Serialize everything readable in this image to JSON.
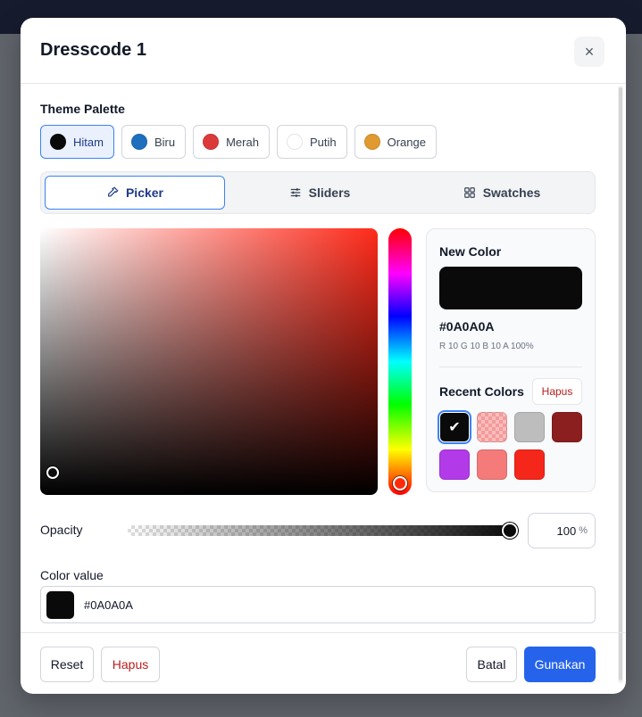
{
  "modal": {
    "title": "Dresscode 1",
    "close_icon": "×"
  },
  "theme_palette": {
    "label": "Theme Palette",
    "items": [
      {
        "label": "Hitam",
        "color": "#0a0a0a",
        "active": true
      },
      {
        "label": "Biru",
        "color": "#1f6fbf",
        "active": false
      },
      {
        "label": "Merah",
        "color": "#dc3a3a",
        "active": false
      },
      {
        "label": "Putih",
        "color": "#ffffff",
        "active": false
      },
      {
        "label": "Orange",
        "color": "#e09a2f",
        "active": false
      }
    ]
  },
  "tabs": [
    {
      "label": "Picker",
      "icon": "eyedropper-icon",
      "active": true
    },
    {
      "label": "Sliders",
      "icon": "sliders-icon",
      "active": false
    },
    {
      "label": "Swatches",
      "icon": "grid-icon",
      "active": false
    }
  ],
  "new_color": {
    "label": "New Color",
    "hex": "#0A0A0A",
    "rgba": "R 10 G 10 B 10 A 100%",
    "color": "#0a0a0a"
  },
  "recent_colors": {
    "label": "Recent Colors",
    "clear_label": "Hapus",
    "swatches": [
      "#0a0a0a",
      "#f59a9a",
      "#bdbdbd",
      "#8b1e1e",
      "#b23ae8",
      "#f57a7a",
      "#f5261a"
    ],
    "selected_index": 0,
    "check_glyph": "✔"
  },
  "opacity": {
    "label": "Opacity",
    "value": "100",
    "unit": "%",
    "level_percent": 100
  },
  "color_value": {
    "label": "Color value",
    "value": "#0A0A0A"
  },
  "footer": {
    "reset_label": "Reset",
    "hapus_label": "Hapus",
    "cancel_label": "Batal",
    "apply_label": "Gunakan"
  },
  "colors": {
    "accent": "#2563eb",
    "danger": "#b91c1c",
    "hue": "#ff2a1a"
  }
}
